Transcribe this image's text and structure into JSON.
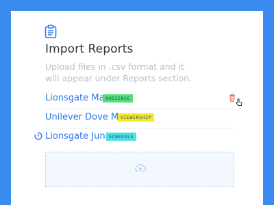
{
  "header": {
    "title": "Import Reports",
    "subtitle": "Upload files in .csv format and it will appear under Reports section.",
    "icon": "clipboard-icon"
  },
  "reports": [
    {
      "name": "Lionsgate May",
      "tag": "AUDIENCE",
      "tag_color": "#4ee07a",
      "status": "hover-delete"
    },
    {
      "name": "Unilever Dove May",
      "tag": "VIEWERSHIP",
      "tag_color": "#f3e82a",
      "status": "idle"
    },
    {
      "name": "Lionsgate June",
      "tag": "SCHEDULE",
      "tag_color": "#4de0e5",
      "status": "loading"
    }
  ],
  "dropzone": {
    "icon": "cloud-upload-icon"
  },
  "colors": {
    "accent": "#2b76e8",
    "frame": "#3a8bf0",
    "delete": "#e96a6a"
  }
}
